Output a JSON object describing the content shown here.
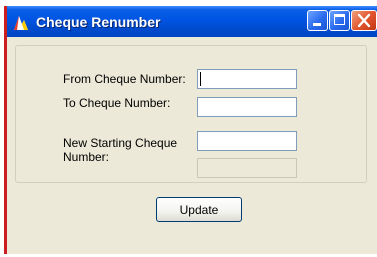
{
  "window": {
    "title": "Cheque Renumber"
  },
  "form": {
    "from_label": "From Cheque Number:",
    "from_value": "",
    "to_label": "To Cheque Number:",
    "to_value": "",
    "new_start_label": "New Starting Cheque Number:",
    "new_start_value": "",
    "extra_value": ""
  },
  "actions": {
    "update_label": "Update"
  },
  "colors": {
    "titlebar": "#0054e3",
    "window_bg": "#ece9d8",
    "close_button": "#e0522a",
    "side_border": "#cc1e1e"
  }
}
